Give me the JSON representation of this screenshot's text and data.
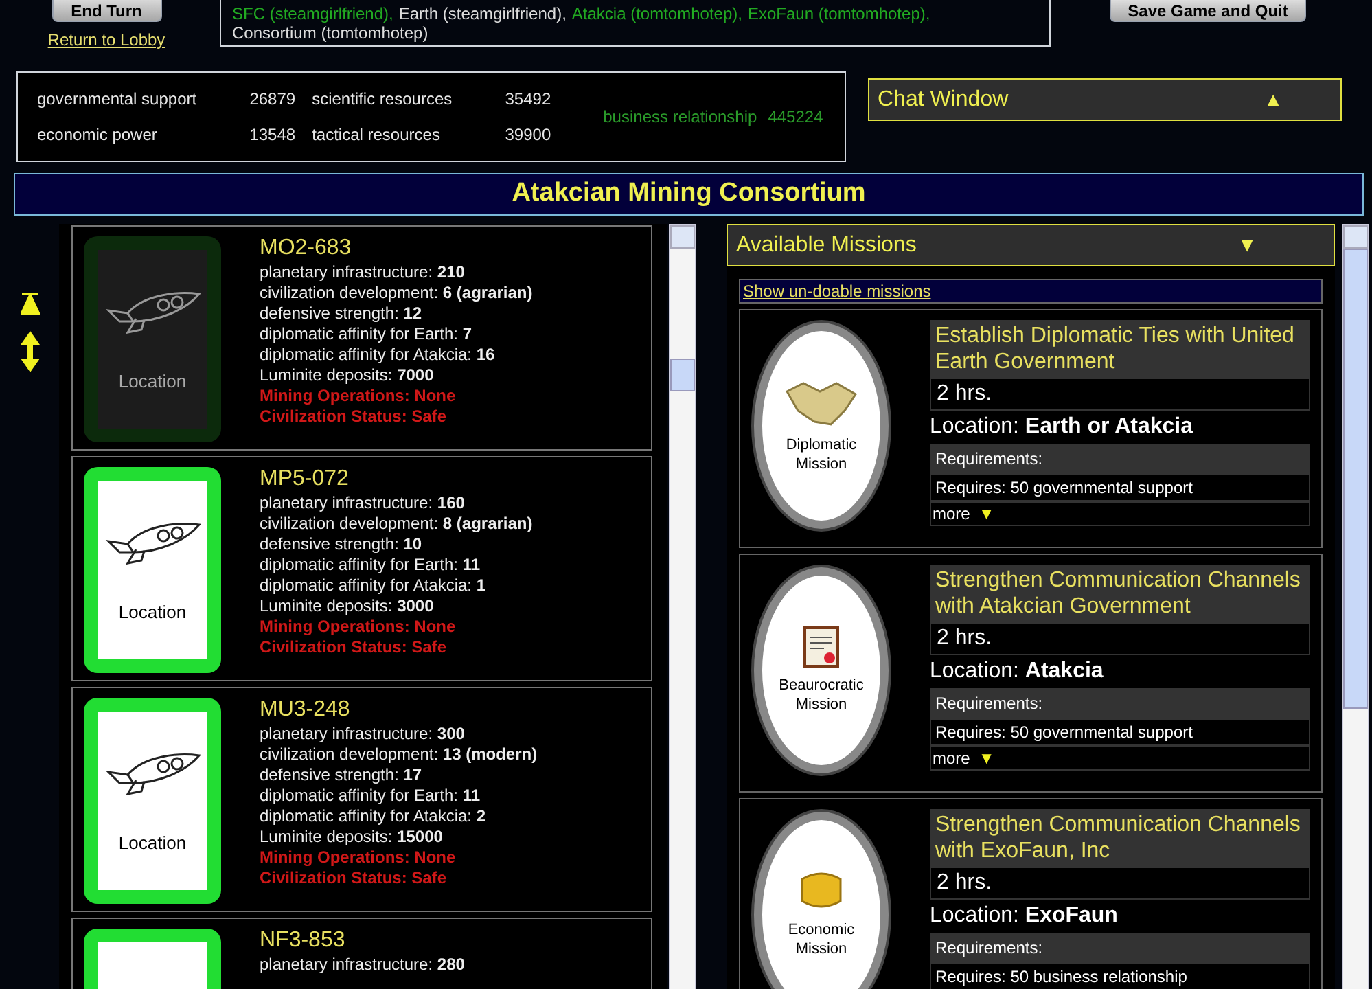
{
  "top_bar": {
    "end_turn": "End Turn",
    "return_link": "Return to Lobby",
    "save_button": "Save Game and Quit",
    "players": [
      {
        "text": "SFC (steamgirlfriend),",
        "color": "#22aa22"
      },
      {
        "text": "Earth (steamgirlfriend),",
        "color": "#dddddd"
      },
      {
        "text": "Atakcia (tomtomhotep),",
        "color": "#22aa22"
      },
      {
        "text": "ExoFaun (tomtomhotep),",
        "color": "#22aa22"
      },
      {
        "text": "Consortium (tomtomhotep)",
        "color": "#dddddd"
      }
    ]
  },
  "resources": [
    {
      "label": "governmental support",
      "value": "26879"
    },
    {
      "label": "economic power",
      "value": "13548"
    },
    {
      "label": "scientific resources",
      "value": "35492"
    },
    {
      "label": "tactical resources",
      "value": "39900"
    }
  ],
  "business": {
    "label": "business relationship",
    "value": "445224"
  },
  "chat": {
    "title": "Chat Window",
    "toggle": "▲"
  },
  "faction_title": "Atakcian Mining Consortium",
  "locations": [
    {
      "name": "MO2-683",
      "card_label": "Location",
      "dimmed": true,
      "stats": [
        {
          "kind": "stat",
          "text": "planetary infrastructure: **210**"
        },
        {
          "kind": "stat",
          "text": "civilization development: **6 (agrarian)**"
        },
        {
          "kind": "stat",
          "text": "defensive strength: **12**"
        },
        {
          "kind": "stat",
          "text": "diplomatic affinity for Earth: **7**"
        },
        {
          "kind": "stat",
          "text": "diplomatic affinity for Atakcia: **16**"
        },
        {
          "kind": "stat",
          "text": "Luminite deposits: **7000**"
        },
        {
          "kind": "status",
          "text": "Mining Operations: None"
        },
        {
          "kind": "status",
          "text": "Civilization Status: Safe"
        }
      ]
    },
    {
      "name": "MP5-072",
      "card_label": "Location",
      "dimmed": false,
      "stats": [
        {
          "kind": "stat",
          "text": "planetary infrastructure: **160**"
        },
        {
          "kind": "stat",
          "text": "civilization development: **8 (agrarian)**"
        },
        {
          "kind": "stat",
          "text": "defensive strength: **10**"
        },
        {
          "kind": "stat",
          "text": "diplomatic affinity for Earth: **11**"
        },
        {
          "kind": "stat",
          "text": "diplomatic affinity for Atakcia: **1**"
        },
        {
          "kind": "stat",
          "text": "Luminite deposits: **3000**"
        },
        {
          "kind": "status",
          "text": "Mining Operations: None"
        },
        {
          "kind": "status",
          "text": "Civilization Status: Safe"
        }
      ]
    },
    {
      "name": "MU3-248",
      "card_label": "Location",
      "dimmed": false,
      "stats": [
        {
          "kind": "stat",
          "text": "planetary infrastructure: **300**"
        },
        {
          "kind": "stat",
          "text": "civilization development: **13 (modern)**"
        },
        {
          "kind": "stat",
          "text": "defensive strength: **17**"
        },
        {
          "kind": "stat",
          "text": "diplomatic affinity for Earth: **11**"
        },
        {
          "kind": "stat",
          "text": "diplomatic affinity for Atakcia: **2**"
        },
        {
          "kind": "stat",
          "text": "Luminite deposits: **15000**"
        },
        {
          "kind": "status",
          "text": "Mining Operations: None"
        },
        {
          "kind": "status",
          "text": "Civilization Status: Safe"
        }
      ]
    },
    {
      "name": "NF3-853",
      "dimmed": false,
      "stats": [
        {
          "kind": "stat",
          "text": "planetary infrastructure: **280**"
        }
      ]
    }
  ],
  "missions_panel": {
    "title": "Available Missions",
    "toggle": "▼",
    "show_link": "Show un-doable missions",
    "missions": [
      {
        "kind": "diplomatic",
        "badge": "Diplomatic Mission",
        "title": "Establish Diplomatic Ties with United Earth Government",
        "duration": "2 hrs.",
        "location": "Location: **Earth or Atakcia**",
        "requirements_label": "Requirements:",
        "requirement": "Requires: 50 governmental support",
        "more": "more",
        "more_icon": "▼"
      },
      {
        "kind": "bureaucratic",
        "badge": "Beaurocratic Mission",
        "title": "Strengthen Communication Channels with Atakcian Government",
        "duration": "2 hrs.",
        "location": "Location: **Atakcia**",
        "requirements_label": "Requirements:",
        "requirement": "Requires: 50 governmental support",
        "more": "more",
        "more_icon": "▼"
      },
      {
        "kind": "economic",
        "badge": "Economic Mission",
        "title": "Strengthen Communication Channels with ExoFaun, Inc",
        "duration": "2 hrs.",
        "location": "Location: **ExoFaun**",
        "requirements_label": "Requirements:",
        "requirement": "Requires: 50 business relationship"
      }
    ]
  }
}
